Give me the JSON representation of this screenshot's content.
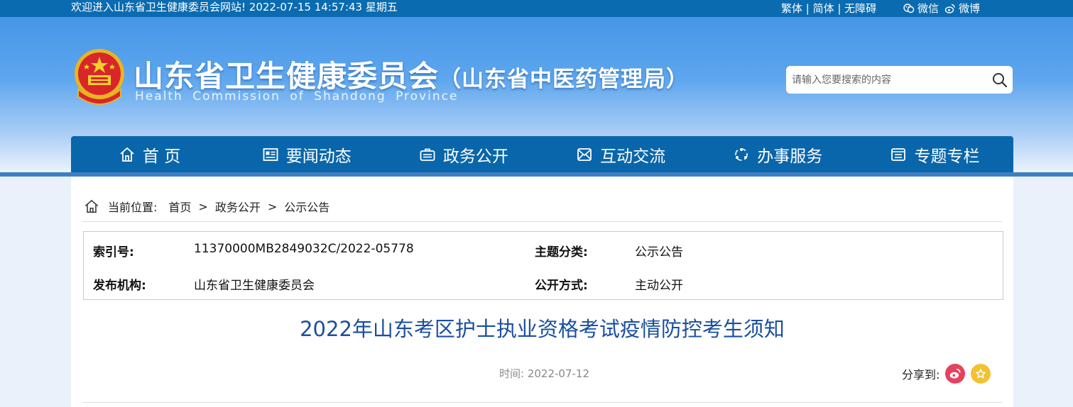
{
  "topbar": {
    "welcome": "欢迎进入山东省卫生健康委员会网站!  2022-07-15 14:57:43 星期五",
    "languages": "繁体 | 简体 | 无障碍",
    "wechat": "微信",
    "weibo": "微博"
  },
  "header": {
    "title": "山东省卫生健康委员会",
    "subtitle": "（山东省中医药管理局）",
    "english": "Health Commission of Shandong Province",
    "search_placeholder": "请输入您要搜索的内容"
  },
  "nav": {
    "items": [
      {
        "label": "首 页",
        "icon": "home-icon"
      },
      {
        "label": "要闻动态",
        "icon": "news-icon"
      },
      {
        "label": "政务公开",
        "icon": "briefcase-icon"
      },
      {
        "label": "互动交流",
        "icon": "interaction-icon"
      },
      {
        "label": "办事服务",
        "icon": "service-icon"
      },
      {
        "label": "专题专栏",
        "icon": "topic-icon"
      }
    ]
  },
  "breadcrumb": {
    "prefix": "当前位置:",
    "items": [
      "首页",
      "政务公开",
      "公示公告"
    ],
    "separator": ">"
  },
  "meta": {
    "index_label": "索引号:",
    "index_value": "11370000MB2849032C/2022-05778",
    "topic_label": "主题分类:",
    "topic_value": "公示公告",
    "publisher_label": "发布机构:",
    "publisher_value": "山东省卫生健康委员会",
    "disclosure_label": "公开方式:",
    "disclosure_value": "主动公开"
  },
  "article": {
    "title": "2022年山东考区护士执业资格考试疫情防控考生须知",
    "time": "时间: 2022-07-12",
    "share_label": "分享到:"
  },
  "colors": {
    "topbar": "#0a6bb0",
    "nav": "#0a66aa",
    "title": "#1a4fa0",
    "weibo": "#e6415e",
    "favorite": "#f2c230"
  }
}
